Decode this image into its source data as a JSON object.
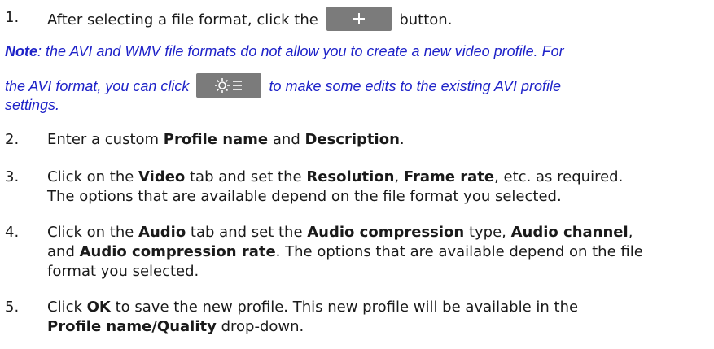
{
  "steps": [
    {
      "num": "1.",
      "pre": "After selecting a file format, click the",
      "post": "button."
    },
    {
      "num": "2.",
      "parts": [
        "Enter a custom ",
        "Profile name",
        " and ",
        "Description",
        "."
      ]
    },
    {
      "num": "3.",
      "line1": [
        "Click on the ",
        "Video",
        " tab and set the ",
        "Resolution",
        ", ",
        "Frame rate",
        ", etc. as required."
      ],
      "line2": "The options that are available depend on the file format you selected."
    },
    {
      "num": "4.",
      "line1": [
        "Click on the ",
        "Audio",
        " tab and set the ",
        "Audio compression",
        " type, ",
        "Audio channel",
        ","
      ],
      "line2": [
        "and ",
        "Audio compression rate",
        ". The options that are available depend on the file"
      ],
      "line3": "format you selected."
    },
    {
      "num": "5.",
      "line1": [
        "Click ",
        "OK",
        " to save the new profile. This new profile will be available in the"
      ],
      "line2": [
        "Profile name/Quality",
        " drop-down."
      ]
    }
  ],
  "note": {
    "label": "Note",
    "line1": ": the AVI and WMV file formats do not allow you to create a new video profile. For",
    "line2_pre": "the AVI format, you can click",
    "line2_post": "to make some edits to the existing AVI profile",
    "line3": "settings."
  },
  "icons": {
    "add": "plus-icon",
    "settings": "gear-menu-icon"
  },
  "colors": {
    "note_text": "#1e22c8",
    "button_bg": "#7b7b7b",
    "icon_fg": "#ffffff"
  }
}
